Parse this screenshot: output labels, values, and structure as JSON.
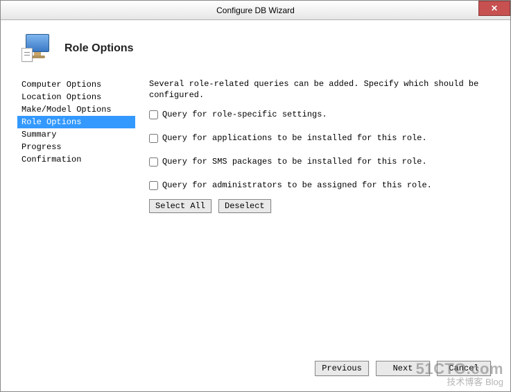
{
  "titlebar": {
    "title": "Configure DB Wizard",
    "close_symbol": "✕"
  },
  "header": {
    "title": "Role Options"
  },
  "sidebar": {
    "items": [
      {
        "label": "Computer Options",
        "selected": false
      },
      {
        "label": "Location Options",
        "selected": false
      },
      {
        "label": "Make/Model Options",
        "selected": false
      },
      {
        "label": "Role Options",
        "selected": true
      },
      {
        "label": "Summary",
        "selected": false
      },
      {
        "label": "Progress",
        "selected": false
      },
      {
        "label": "Confirmation",
        "selected": false
      }
    ]
  },
  "main": {
    "instruction": "Several role-related queries can be added.  Specify which should be configured.",
    "checkboxes": [
      {
        "label": "Query for role-specific settings.",
        "checked": false
      },
      {
        "label": "Query for applications to be installed for this role.",
        "checked": false
      },
      {
        "label": "Query for SMS packages to be installed for this role.",
        "checked": false
      },
      {
        "label": "Query for administrators to be assigned for this role.",
        "checked": false
      }
    ],
    "select_all_label": "Select All",
    "deselect_label": "Deselect"
  },
  "footer": {
    "previous_label": "Previous",
    "next_label": "Next",
    "cancel_label": "Cancel"
  },
  "watermark": {
    "line1": "51CTO.com",
    "line2": "技术博客 Blog"
  }
}
